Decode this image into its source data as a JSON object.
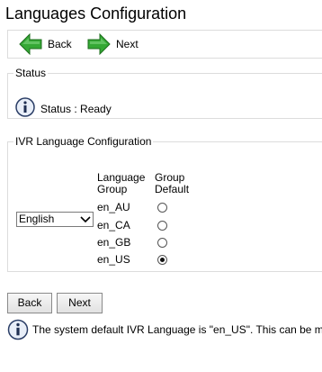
{
  "page": {
    "title": "Languages Configuration"
  },
  "toolbar": {
    "back_label": "Back",
    "next_label": "Next",
    "back_icon": "arrow-left-icon",
    "next_icon": "arrow-right-icon",
    "icon_color": "#2e9a2e"
  },
  "status": {
    "legend": "Status",
    "text": "Status : Ready",
    "icon": "info-icon"
  },
  "ivr": {
    "legend": "IVR Language Configuration",
    "language_select": {
      "value": "English"
    },
    "headers": {
      "group_line1": "Language",
      "group_line2": "Group",
      "default_line1": "Group",
      "default_line2": "Default"
    },
    "groups": [
      {
        "label": "en_AU",
        "default": false
      },
      {
        "label": "en_CA",
        "default": false
      },
      {
        "label": "en_GB",
        "default": false
      },
      {
        "label": "en_US",
        "default": true
      }
    ]
  },
  "buttons": {
    "back_label": "Back",
    "next_label": "Next"
  },
  "footer": {
    "text": "The system default IVR Language is \"en_US\". This can be m",
    "icon": "info-icon"
  }
}
